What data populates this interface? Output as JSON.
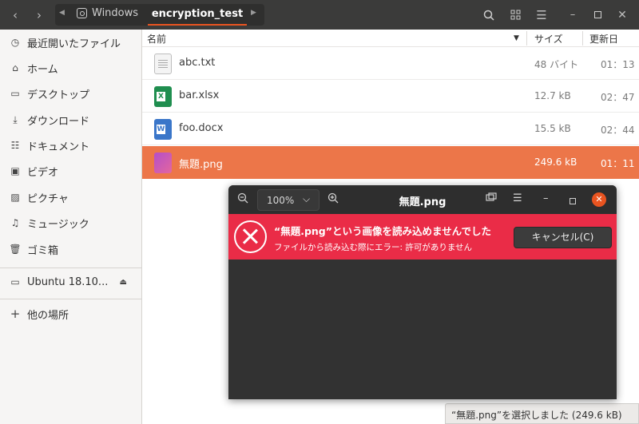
{
  "header": {
    "back_icon": "chevron-left-icon",
    "forward_icon": "chevron-right-icon",
    "path": [
      {
        "label": "Windows",
        "icon": "drive-icon"
      },
      {
        "label": "encryption_test",
        "current": true
      }
    ],
    "accent_color": "#e95420"
  },
  "sidebar": {
    "items": [
      {
        "label": "最近開いたファイル",
        "icon": "clock-icon"
      },
      {
        "label": "ホーム",
        "icon": "home-icon"
      },
      {
        "label": "デスクトップ",
        "icon": "desktop-icon"
      },
      {
        "label": "ダウンロード",
        "icon": "download-icon"
      },
      {
        "label": "ドキュメント",
        "icon": "document-icon"
      },
      {
        "label": "ビデオ",
        "icon": "video-icon"
      },
      {
        "label": "ピクチャ",
        "icon": "picture-icon"
      },
      {
        "label": "ミュージック",
        "icon": "music-icon"
      },
      {
        "label": "ゴミ箱",
        "icon": "trash-icon"
      }
    ],
    "device": {
      "label": "Ubuntu 18.10...",
      "icon": "drive-icon"
    },
    "other": {
      "label": "他の場所",
      "icon": "plus-icon"
    }
  },
  "columns": {
    "name": "名前",
    "size": "サイズ",
    "modified": "更新日"
  },
  "files": [
    {
      "name": "abc.txt",
      "size": "48 バイト",
      "modified": "01：13",
      "type": "txt"
    },
    {
      "name": "bar.xlsx",
      "size": "12.7 kB",
      "modified": "02：47",
      "type": "xlsx"
    },
    {
      "name": "foo.docx",
      "size": "15.5 kB",
      "modified": "02：44",
      "type": "docx"
    },
    {
      "name": "無題.png",
      "size": "249.6 kB",
      "modified": "01：11",
      "type": "png",
      "selected": true
    }
  ],
  "status_text": "“無題.png”を選択しました (249.6 kB)",
  "viewer": {
    "zoom": "100%",
    "title": "無題.png",
    "error_title": "“無題.png”という画像を読み込めませんでした",
    "error_detail": "ファイルから読み込む際にエラー: 許可がありません",
    "cancel_label": "キャンセル(C)",
    "error_color": "#ea2c47"
  }
}
